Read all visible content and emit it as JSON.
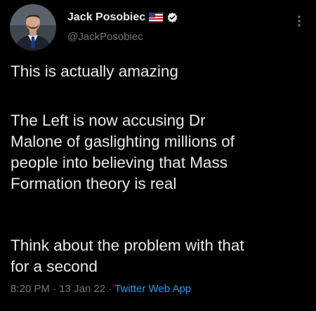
{
  "author": {
    "name": "Jack Posobiec",
    "handle": "@JackPosobiec"
  },
  "tweet": {
    "paragraph1": "This is actually amazing",
    "paragraph2_lines": [
      "The Left is now accusing Dr",
      "Malone of gaslighting millions of",
      "people into believing that Mass",
      "Formation theory is real"
    ],
    "paragraph3_lines": [
      "Think about the problem with that",
      "for a second"
    ]
  },
  "meta": {
    "time": "8:20 PM",
    "separator1": "·",
    "date": "13 Jan 22",
    "separator2": "·",
    "source": "Twitter Web App"
  },
  "icons": {
    "flag": "us-flag-icon",
    "verified": "verified-badge-icon",
    "more": "more-options-icon"
  },
  "colors": {
    "background": "#000000",
    "text": "#e7e9ea",
    "secondary": "#71767b",
    "link": "#1d9bf0"
  }
}
